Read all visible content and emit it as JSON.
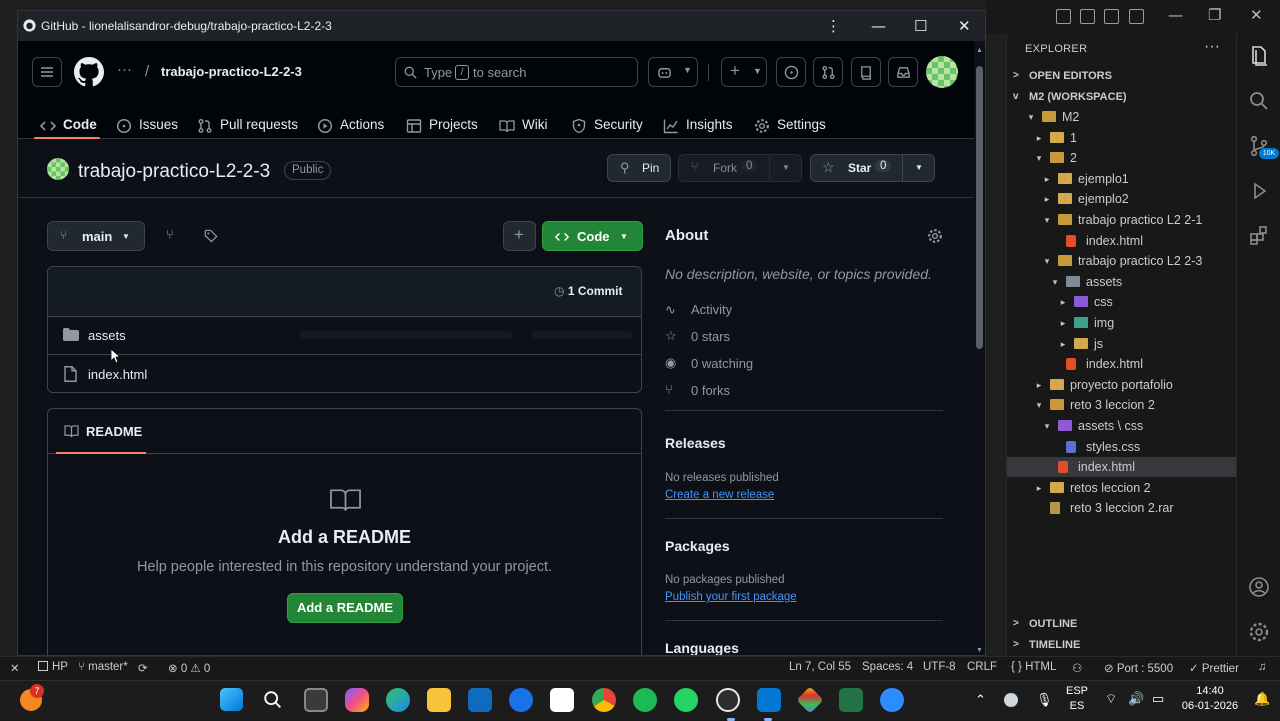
{
  "browser": {
    "title": "GitHub - lionelalisandror-debug/trabajo-practico-L2-2-3",
    "controls": [
      "⋮",
      "—",
      "☐",
      "✕"
    ]
  },
  "header": {
    "repo_path": "trabajo-practico-L2-2-3",
    "search_placeholder_before": "Type",
    "search_key": "/",
    "search_placeholder_after": "to search"
  },
  "tabs": [
    {
      "label": "Code",
      "icon": "code-icon"
    },
    {
      "label": "Issues",
      "icon": "issues-icon"
    },
    {
      "label": "Pull requests",
      "icon": "pull-request-icon"
    },
    {
      "label": "Actions",
      "icon": "actions-icon"
    },
    {
      "label": "Projects",
      "icon": "projects-icon"
    },
    {
      "label": "Wiki",
      "icon": "wiki-icon"
    },
    {
      "label": "Security",
      "icon": "shield-icon"
    },
    {
      "label": "Insights",
      "icon": "graph-icon"
    },
    {
      "label": "Settings",
      "icon": "gear-icon"
    }
  ],
  "repo": {
    "name": "trabajo-practico-L2-2-3",
    "visibility": "Public",
    "pin_label": "Pin",
    "fork_label": "Fork",
    "fork_count": "0",
    "star_label": "Star",
    "star_count": "0"
  },
  "branch": {
    "name": "main",
    "code_button": "Code",
    "commits": "1 Commit"
  },
  "files": [
    {
      "name": "assets",
      "type": "folder"
    },
    {
      "name": "index.html",
      "type": "file"
    }
  ],
  "readme": {
    "tab_label": "README",
    "heading": "Add a README",
    "description": "Help people interested in this repository understand your project.",
    "button": "Add a README"
  },
  "about": {
    "title": "About",
    "description": "No description, website, or topics provided.",
    "activity": "Activity",
    "stars": "0 stars",
    "watching": "0 watching",
    "forks": "0 forks"
  },
  "releases": {
    "title": "Releases",
    "empty": "No releases published",
    "link": "Create a new release"
  },
  "packages": {
    "title": "Packages",
    "empty": "No packages published",
    "link": "Publish your first package"
  },
  "languages": {
    "title": "Languages"
  },
  "vscode": {
    "explorer_title": "EXPLORER",
    "explorer_more": "···",
    "open_editors": "OPEN EDITORS",
    "workspace": "M2 (WORKSPACE)",
    "outline": "OUTLINE",
    "timeline": "TIMELINE",
    "badge": "10K",
    "tree": [
      {
        "label": "M2",
        "depth": 0,
        "chev": "v",
        "icon": "folder-open"
      },
      {
        "label": "1",
        "depth": 1,
        "chev": ">",
        "icon": "folder"
      },
      {
        "label": "2",
        "depth": 1,
        "chev": "v",
        "icon": "folder-open"
      },
      {
        "label": "ejemplo1",
        "depth": 2,
        "chev": ">",
        "icon": "folder"
      },
      {
        "label": "ejemplo2",
        "depth": 2,
        "chev": ">",
        "icon": "folder"
      },
      {
        "label": "trabajo practico L2 2-1",
        "depth": 2,
        "chev": "v",
        "icon": "folder-open"
      },
      {
        "label": "index.html",
        "depth": 3,
        "chev": "",
        "icon": "html"
      },
      {
        "label": "trabajo practico L2 2-3",
        "depth": 2,
        "chev": "v",
        "icon": "folder-open"
      },
      {
        "label": "assets",
        "depth": 3,
        "chev": "v",
        "icon": "folder-gray"
      },
      {
        "label": "css",
        "depth": 4,
        "chev": ">",
        "icon": "folder-purple"
      },
      {
        "label": "img",
        "depth": 4,
        "chev": ">",
        "icon": "folder-teal"
      },
      {
        "label": "js",
        "depth": 4,
        "chev": ">",
        "icon": "folder"
      },
      {
        "label": "index.html",
        "depth": 3,
        "chev": "",
        "icon": "html"
      },
      {
        "label": "proyecto portafolio",
        "depth": 1,
        "chev": ">",
        "icon": "folder"
      },
      {
        "label": "reto 3 leccion 2",
        "depth": 1,
        "chev": "v",
        "icon": "folder-open"
      },
      {
        "label": "assets \\ css",
        "depth": 2,
        "chev": "v",
        "icon": "folder-purple"
      },
      {
        "label": "styles.css",
        "depth": 3,
        "chev": "",
        "icon": "css"
      },
      {
        "label": "index.html",
        "depth": 2,
        "chev": "",
        "icon": "html",
        "selected": true
      },
      {
        "label": "retos leccion 2",
        "depth": 1,
        "chev": ">",
        "icon": "folder"
      },
      {
        "label": "reto 3 leccion 2.rar",
        "depth": 1,
        "chev": "",
        "icon": "rar"
      }
    ],
    "status": {
      "remote": "✕",
      "hp": "HP",
      "branch": "master*",
      "problems": "⊗ 0 ⚠ 0",
      "position": "Ln 7, Col 55",
      "spaces": "Spaces: 4",
      "encoding": "UTF-8",
      "eol": "CRLF",
      "language": "{ } HTML",
      "port": "Port : 5500",
      "prettier": "✓ Prettier"
    }
  },
  "taskbar": {
    "lang_top": "ESP",
    "lang_bottom": "ES",
    "time": "14:40",
    "date": "06-01-2026",
    "notification_count": "7"
  },
  "colors": {
    "accent_green": "#238636",
    "link_blue": "#4493f8",
    "tab_underline": "#f78166",
    "bg_dark": "#0d1117"
  }
}
